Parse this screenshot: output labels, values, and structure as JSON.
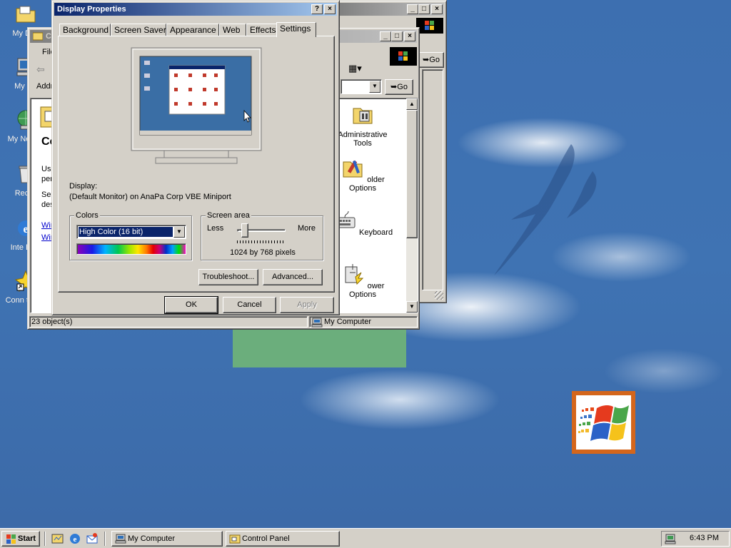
{
  "desktop": {
    "icons": [
      {
        "label": "My Documents",
        "name": "desktop-icon-my-documents"
      },
      {
        "label": "My Computer",
        "name": "desktop-icon-my-computer"
      },
      {
        "label": "My Network Places",
        "name": "desktop-icon-my-network-places"
      },
      {
        "label": "Recycle Bin",
        "name": "desktop-icon-recycle-bin"
      },
      {
        "label": "Internet Explorer",
        "name": "desktop-icon-internet-explorer"
      },
      {
        "label": "Connect to the Internet",
        "name": "desktop-icon-connect-internet"
      }
    ],
    "icon_visible_labels": [
      "My Doc",
      "My Co",
      "My Ne Pla",
      "Recyc",
      "Inte Expl",
      "Conn the In"
    ]
  },
  "display_properties": {
    "title": "Display Properties",
    "help_button": "?",
    "close_button": "×",
    "tabs": [
      "Background",
      "Screen Saver",
      "Appearance",
      "Web",
      "Effects",
      "Settings"
    ],
    "selected_tab": "Settings",
    "display_label": "Display:",
    "display_value": "(Default Monitor) on AnaPa Corp VBE Miniport",
    "colors": {
      "legend": "Colors",
      "selected": "High Color (16 bit)"
    },
    "screen_area": {
      "legend": "Screen area",
      "less": "Less",
      "more": "More",
      "value": "1024 by 768 pixels",
      "slider_position": 0.1
    },
    "buttons": {
      "troubleshoot": "Troubleshoot...",
      "advanced": "Advanced...",
      "ok": "OK",
      "cancel": "Cancel",
      "apply": "Apply"
    }
  },
  "control_panel": {
    "title": "Co",
    "menu_first": "File",
    "address_label": "Addr",
    "go_label": "Go",
    "left_heading": "Co",
    "left_text": [
      "Use",
      "pers",
      "Sele",
      "des"
    ],
    "left_links": [
      "Win",
      "Win"
    ],
    "items": [
      "Administrative Tools",
      "Folder Options",
      "Keyboard",
      "Power Options"
    ],
    "item_visible_labels": [
      "Administrative Tools",
      "older Options",
      "Keyboard",
      "ower Options"
    ],
    "status_left": "23 object(s)",
    "status_right": "My Computer"
  },
  "my_computer": {
    "go_label": "Go"
  },
  "taskbar": {
    "start_label": "Start",
    "tasks": [
      "My Computer",
      "Control Panel"
    ],
    "clock": "6:43 PM"
  },
  "colors": {
    "desktop": "#3a6ea5",
    "title_active": "#0a246a",
    "title_inactive": "#808080",
    "face": "#d4d0c8",
    "selection": "#0a246a"
  }
}
